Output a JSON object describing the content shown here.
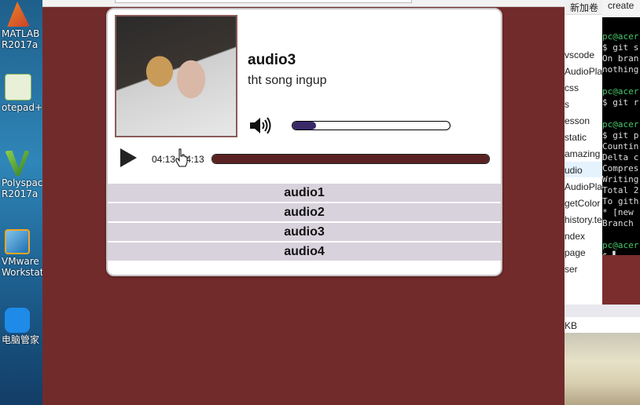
{
  "desktop": {
    "icons": [
      {
        "label_line1": "MATLAB",
        "label_line2": "R2017a",
        "icon": "matlab-icon"
      },
      {
        "label_line1": "otepad+",
        "label_line2": "",
        "icon": "notepad-icon"
      },
      {
        "label_line1": "Polyspace",
        "label_line2": "R2017a",
        "icon": "polyspace-icon"
      },
      {
        "label_line1": "VMware",
        "label_line2": "Workstati...",
        "icon": "vmware-icon"
      },
      {
        "label_line1": "电脑管家",
        "label_line2": "",
        "icon": "shield-icon"
      }
    ]
  },
  "player": {
    "current_title": "audio3",
    "current_artist": "tht song ingup",
    "time_display": "04:13 /04:13",
    "volume_level": 0.15,
    "progress": 1.0,
    "play_icon": "play-icon",
    "volume_icon": "volume-icon",
    "playlist": [
      "audio1",
      "audio2",
      "audio3",
      "audio4"
    ]
  },
  "explorer": {
    "header": "新加卷",
    "items": [
      "vscode",
      "AudioPla",
      "css",
      "s",
      "esson",
      "static",
      "amazing",
      "udio",
      "AudioPla",
      "getColor",
      "history.te",
      "ndex",
      "page",
      "ser"
    ],
    "footer": "KB"
  },
  "terminal": {
    "top_text": "create",
    "lines": [
      {
        "text": "",
        "cls": ""
      },
      {
        "text": "pc@acer",
        "cls": "green"
      },
      {
        "text": "$ git s",
        "cls": ""
      },
      {
        "text": "On bran",
        "cls": ""
      },
      {
        "text": "nothing",
        "cls": ""
      },
      {
        "text": "",
        "cls": ""
      },
      {
        "text": "pc@acer",
        "cls": "green"
      },
      {
        "text": "$ git r",
        "cls": ""
      },
      {
        "text": "",
        "cls": ""
      },
      {
        "text": "pc@acer",
        "cls": "green"
      },
      {
        "text": "$ git p",
        "cls": ""
      },
      {
        "text": "Countin",
        "cls": ""
      },
      {
        "text": "Delta c",
        "cls": ""
      },
      {
        "text": "Compres",
        "cls": ""
      },
      {
        "text": "Writing",
        "cls": ""
      },
      {
        "text": "Total 2",
        "cls": ""
      },
      {
        "text": "To gith",
        "cls": ""
      },
      {
        "text": " * [new",
        "cls": ""
      },
      {
        "text": "Branch ",
        "cls": ""
      },
      {
        "text": "",
        "cls": ""
      },
      {
        "text": "pc@acer",
        "cls": "green"
      },
      {
        "text": "$ ▌",
        "cls": ""
      }
    ]
  }
}
